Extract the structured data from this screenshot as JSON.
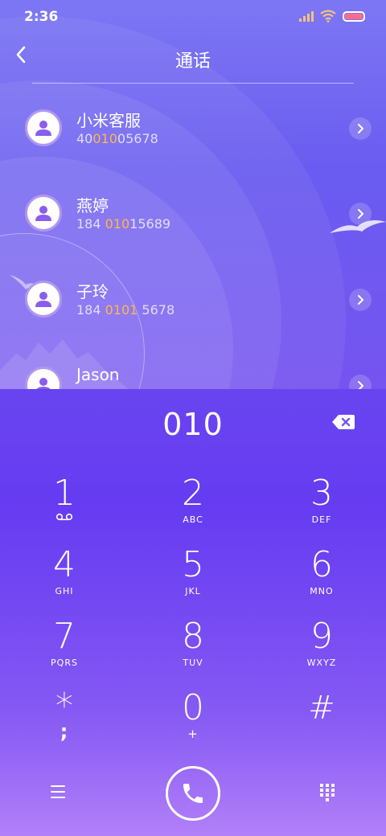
{
  "status_bar": {
    "time": "2:36"
  },
  "header": {
    "title": "通话"
  },
  "contacts": [
    {
      "name": "小米客服",
      "number_pre": "40",
      "number_hl": "010",
      "number_post": "05678"
    },
    {
      "name": "燕婷",
      "number_pre": "184 ",
      "number_hl": "010",
      "number_post": "15689"
    },
    {
      "name": "子玲",
      "number_pre": "184 ",
      "number_hl": "0101",
      "number_post": " 5678"
    },
    {
      "name": "Jason",
      "number_pre": "",
      "number_hl": "",
      "number_post": ""
    }
  ],
  "dialer": {
    "input": "010",
    "keys": [
      {
        "digit": "1",
        "letters": ""
      },
      {
        "digit": "2",
        "letters": "ABC"
      },
      {
        "digit": "3",
        "letters": "DEF"
      },
      {
        "digit": "4",
        "letters": "GHI"
      },
      {
        "digit": "5",
        "letters": "JKL"
      },
      {
        "digit": "6",
        "letters": "MNO"
      },
      {
        "digit": "7",
        "letters": "PQRS"
      },
      {
        "digit": "8",
        "letters": "TUV"
      },
      {
        "digit": "9",
        "letters": "WXYZ"
      },
      {
        "digit": "*",
        "letters": ";"
      },
      {
        "digit": "0",
        "letters": "+"
      },
      {
        "digit": "#",
        "letters": ""
      }
    ]
  },
  "colors": {
    "highlight": "#ffb74a",
    "accent": "#6a4af2"
  },
  "icons": {
    "back": "chevron-left-icon",
    "chevron": "chevron-right-icon",
    "backspace": "backspace-icon",
    "voicemail": "voicemail-icon",
    "menu": "menu-icon",
    "call": "phone-icon",
    "dialpad": "dialpad-icon"
  }
}
